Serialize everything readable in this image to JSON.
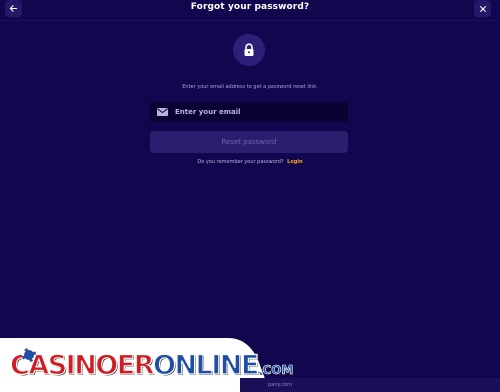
{
  "header": {
    "title": "Forgot your password?",
    "back_icon": "arrow-left-icon",
    "close_icon": "close-icon"
  },
  "lock_icon": "lock-icon",
  "instruction": "Enter your email address to get a password reset link.",
  "email": {
    "icon": "mail-icon",
    "placeholder": "Enter your email",
    "value": ""
  },
  "reset_button": {
    "label": "Reset password"
  },
  "remember": {
    "text": "Do you remember your password?",
    "login_label": "Login"
  },
  "watermark": {
    "logo_part1": "CASINOER",
    "logo_part2": "ONLINE",
    "logo_tld": ".COM",
    "footer_fragment": "pany.com"
  },
  "colors": {
    "background": "#12064f",
    "field": "#090233",
    "button_disabled": "#2a1e6e",
    "link": "#f5a623"
  }
}
